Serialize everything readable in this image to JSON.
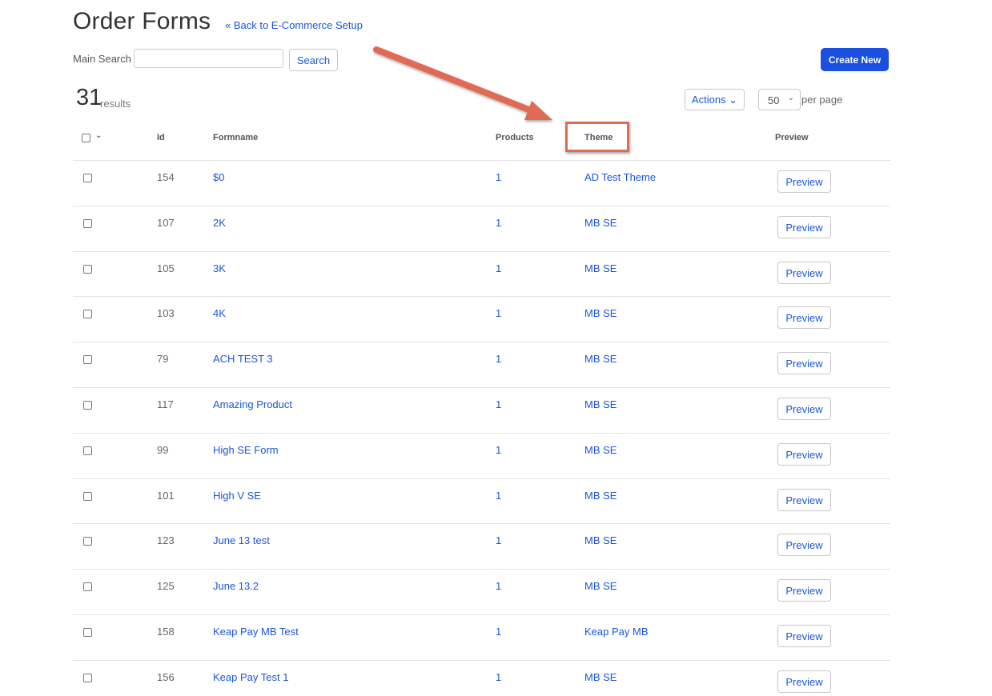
{
  "header": {
    "title": "Order Forms",
    "back_link": "« Back to E-Commerce Setup",
    "search_label": "Main Search",
    "search_value": "",
    "search_button": "Search",
    "create_button": "Create New"
  },
  "results": {
    "count": "31",
    "label": "results"
  },
  "toolbar": {
    "actions_label": "Actions ⌄",
    "per_page_value": "50",
    "per_page_label": "per page"
  },
  "table": {
    "columns": [
      "Id",
      "Formname",
      "Products",
      "Theme",
      "Preview"
    ],
    "rows": [
      {
        "id": "154",
        "formname": "$0",
        "products": "1",
        "theme": "AD Test Theme",
        "preview": "Preview"
      },
      {
        "id": "107",
        "formname": "2K",
        "products": "1",
        "theme": "MB SE",
        "preview": "Preview"
      },
      {
        "id": "105",
        "formname": "3K",
        "products": "1",
        "theme": "MB SE",
        "preview": "Preview"
      },
      {
        "id": "103",
        "formname": "4K",
        "products": "1",
        "theme": "MB SE",
        "preview": "Preview"
      },
      {
        "id": "79",
        "formname": "ACH TEST 3",
        "products": "1",
        "theme": "MB SE",
        "preview": "Preview"
      },
      {
        "id": "117",
        "formname": "Amazing Product",
        "products": "1",
        "theme": "MB SE",
        "preview": "Preview"
      },
      {
        "id": "99",
        "formname": "High SE Form",
        "products": "1",
        "theme": "MB SE",
        "preview": "Preview"
      },
      {
        "id": "101",
        "formname": "High V SE",
        "products": "1",
        "theme": "MB SE",
        "preview": "Preview"
      },
      {
        "id": "123",
        "formname": "June 13 test",
        "products": "1",
        "theme": "MB SE",
        "preview": "Preview"
      },
      {
        "id": "125",
        "formname": "June 13.2",
        "products": "1",
        "theme": "MB SE",
        "preview": "Preview"
      },
      {
        "id": "158",
        "formname": "Keap Pay MB Test",
        "products": "1",
        "theme": "Keap Pay MB",
        "preview": "Preview"
      },
      {
        "id": "156",
        "formname": "Keap Pay Test 1",
        "products": "1",
        "theme": "MB SE",
        "preview": "Preview"
      }
    ]
  },
  "colors": {
    "link": "#1a56db",
    "primary_button": "#1a4fe0",
    "annotation": "#e06a54"
  },
  "icons": {
    "select_all_chevron": "chevron-down-icon",
    "per_page_chevron": "chevron-down-icon",
    "annotation": "arrow-annotation-icon"
  }
}
